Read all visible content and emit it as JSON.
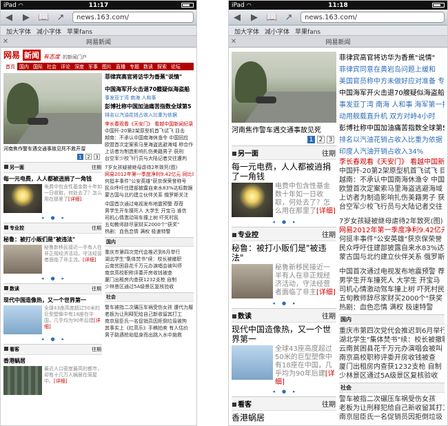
{
  "left": {
    "status": {
      "carrier": "iPad",
      "time": "11:17"
    },
    "url": "news.163.com/",
    "bookmarks": [
      "加大字体",
      "减小字体",
      "苹果fans"
    ],
    "tab_title": "网易新闻",
    "logo": {
      "brand": "网易",
      "box": "新闻",
      "slogan": "有态度",
      "tagline": "的新闻门户"
    },
    "nav": [
      "首页",
      "国内",
      "国际",
      "社会",
      "评论",
      "深度",
      "军事",
      "图片",
      "直播",
      "专题",
      "数读",
      "探索",
      "论坛"
    ],
    "photo_caption": "河南焦作警车遇交通事故见死不救开溜",
    "pager": [
      "1",
      "2",
      "3"
    ],
    "headlines": [
      "菲律宾高官将访华为香蕉\"说情\"",
      "中国海军开火击退70艘疑似海盗船",
      "彭博社称中国加油痛苦指数全球第5"
    ],
    "subs": [
      "事发亚丁湾 南海 人和事",
      "排名以汽油花钱占收入比重为依据"
    ],
    "list1": [
      "李长春观看《天安门》 看越中国新闻纪录片",
      "中国歼-20第2架原型机首飞试飞 目击",
      "越南：不承认中国南海休渔令 中国回应",
      "欧盟首次定案索马里海盗逃避海域 称合作",
      "上访者为制造影响扎伤美籍男子 获刑",
      "台空军少校飞行员与大陆记者交往遭判"
    ],
    "list2": [
      "7岁女孩疑被继母虐待2年致死(图)",
      "网易2012年第一季度净利9.42亿元 同比增",
      "何挺丰事件\"公安英雄\"获京保荣誉称号",
      "民众呼吁住建部披露自来水83%达标数据",
      "蒙古国与北约建立伙伴关系 俄罗斯关注"
    ],
    "list3": [
      "中国首次通过电视发布地震预警 荐荐",
      "男学生开车撞死人 大学生 开宝马 谁信",
      "司机心情激动驾车撞上树 吓死村民",
      "五旬教师辞尽家财买2000个\"获奖\"",
      "热剧：血色恋情 满权 极速特警"
    ],
    "sec_domestic": "国内",
    "list4": [
      "重庆市第四次党代会推迟到6月举行",
      "湖北学生\"集体焚书\"续：校长被撤职",
      "云南贫困县花千万元办演唱会被叫停",
      "南京高校职称评委开房收钱被查",
      "厦门出租房内查获1232支枪 自制",
      "少林景区通过5A级景区复核验收"
    ],
    "sec_society": "社会",
    "list5": [
      "警车被指二次碾压车祸受伤女孩 遭代为履",
      "老板为让刑释犯给自己新收留其打工",
      "南京屈臣氏一名促销员因拒倒垃圾被拘",
      "其事实上《红高乐》手稿拍卖 有人估价",
      "男子路遇抢劫挺身而出跳入水中施救"
    ],
    "sections": [
      {
        "name": "另一面",
        "more": "往期",
        "title": "每一元电费，人人都被逍捐了一角钱",
        "text": "电费中包含性基金数十年如一日收取，何处去了？怎么用在那里了",
        "link": "[详细]"
      },
      {
        "name": "专业控",
        "more": "往期",
        "title": "秘鲁：被打小贩们是\"被违法\"",
        "text": "秘鲁新移民接近一半有人在非正规经济活动，守法经营者面临了非主流。",
        "link": "[详细]"
      },
      {
        "name": "数读",
        "more": "往期",
        "title": "现代中国造像热，又一个世界第一",
        "text": "全球43座高度超过50米的巨型塑像中有18座在中国，几乎均为90年后建",
        "link": "[详细]"
      },
      {
        "name": "看客",
        "more": "往期",
        "title": "香港蜗居",
        "text": "最近人口密度最高的都市，却有十几万人蜗居在笼屋中。",
        "link": "[详细]"
      }
    ]
  },
  "right": {
    "status": {
      "carrier": "iPad",
      "time": "11:18"
    },
    "url": "news.163.com/",
    "bookmarks": [
      "加大字体",
      "减小字体",
      "苹果fans"
    ],
    "tab_title": "网易新闻",
    "photo_caption": "河南焦作警车遇交通事故见死",
    "pager": [
      "1",
      "2",
      "3"
    ],
    "headlines": [
      "菲律宾高官将访华为香蕉\"说情\"",
      "中国海军开火击退70艘疑似海盗船",
      "彭博社称中国加油痛苦指数全球第5"
    ],
    "subs": [
      "菲律宾同意在黄岩岛问题上缓和",
      "美国官员称中方未做好应对准备 专题",
      "事发亚丁湾 南海 人和事 海军第一批护航",
      "动用舰载直升机 双方对峙4小时",
      "排名以汽油花销占收入比重为依据",
      "印度人汽油开销占收入34%"
    ],
    "list1": [
      "李长春观看《天安门》 看越中国新",
      "中国歼-20第2架原型机首飞试飞 目",
      "越南：不承认中国南海休渔令 中国",
      "欧盟首次定案索马里海盗逃避海域",
      "上访者为制造影响扎伤美籍男子 获",
      "台空军少校飞行员与大陆记者交往"
    ],
    "list2": [
      "7岁女孩疑被继母虐待2年致死(图)",
      "网易2012年第一季度净利9.42亿元",
      "何挺丰事件\"公安英雄\"获京保荣誉",
      "民众呼吁住建部披露自来水83%达标",
      "蒙古国与北约建立伙伴关系 俄罗斯"
    ],
    "list3": [
      "中国首次通过电视发布地震预警 荐",
      "男学生开车撞死人 大学生 开宝马",
      "司机心情激动驾车撞上树 吓死村民",
      "五旬教师辞尽家财买2000个\"获奖",
      "热剧：血色恋情 满权 极速特警"
    ],
    "sec_domestic": "国内",
    "list4": [
      "重庆市第四次党代会推迟到6月举行",
      "湖北学生\"集体焚书\"续：校长被撤职",
      "云南贫困县花千万元办演唱会被叫",
      "南京高校职称评委开房收钱被查",
      "厦门出租房内查获1232支枪 自制",
      "少林景区通过5A级景区复核验收"
    ],
    "sec_society": "社会",
    "list5": [
      "警车被指二次碾压车祸受伤女孩",
      "老板为让刑释犯给自己新收留其打工",
      "南京屈臣氏一名促销员因拒倒垃圾"
    ],
    "sections": [
      {
        "name": "另一面",
        "more": "往期",
        "title": "每一元电费，人人都被逍捐了一角钱",
        "text": "电费中包含性基金数十年如一日收取，何处去了？怎么用在那里了",
        "link": "[详细]"
      },
      {
        "name": "专业控",
        "more": "往期",
        "title": "秘鲁：被打小贩们是\"被违法\"",
        "text": "秘鲁新移民接近一半有人在非正规经济活动，守法经营者面临了非主",
        "link": "[详细]"
      },
      {
        "name": "数读",
        "more": "往期",
        "title": "现代中国造像热，又一个世界第一",
        "text": "全球43座高度超过50米的巨型塑像中有18座在中国，几乎均为90年后建",
        "link": "[详细]"
      },
      {
        "name": "看客",
        "more": "往期",
        "title": "香港蜗居",
        "text": "",
        "link": ""
      }
    ]
  }
}
